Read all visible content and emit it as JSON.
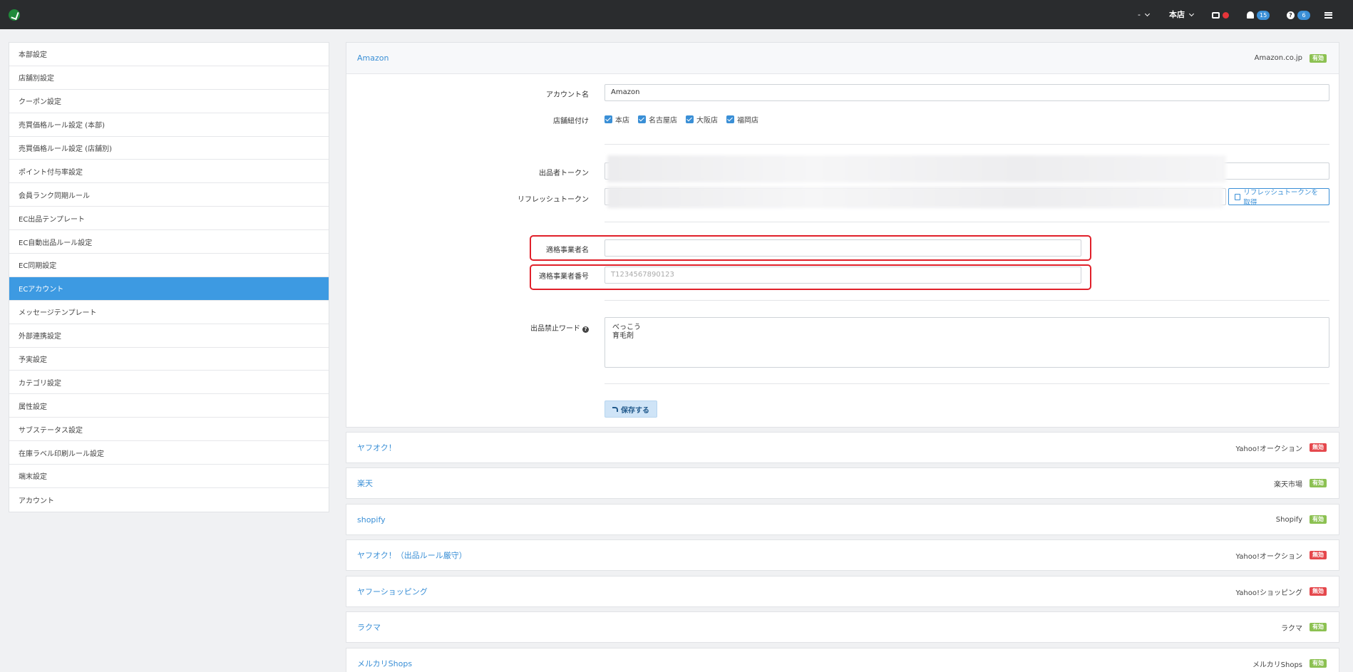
{
  "topbar": {
    "account_label": "-",
    "store_label": "本店",
    "notifications_count": "15",
    "help_count": "6"
  },
  "sidebar": {
    "items": [
      {
        "label": "本部設定"
      },
      {
        "label": "店舗別設定"
      },
      {
        "label": "クーポン設定"
      },
      {
        "label": "売買価格ルール設定 (本部)"
      },
      {
        "label": "売買価格ルール設定 (店舗別)"
      },
      {
        "label": "ポイント付与率設定"
      },
      {
        "label": "会員ランク同期ルール"
      },
      {
        "label": "EC出品テンプレート"
      },
      {
        "label": "EC自動出品ルール設定"
      },
      {
        "label": "EC同期設定"
      },
      {
        "label": "ECアカウント"
      },
      {
        "label": "メッセージテンプレート"
      },
      {
        "label": "外部連携設定"
      },
      {
        "label": "予実設定"
      },
      {
        "label": "カテゴリ設定"
      },
      {
        "label": "属性設定"
      },
      {
        "label": "サブステータス設定"
      },
      {
        "label": "在庫ラベル印刷ルール設定"
      },
      {
        "label": "端末設定"
      },
      {
        "label": "アカウント"
      }
    ],
    "active_index": 10
  },
  "amazon": {
    "title": "Amazon",
    "store": "Amazon.co.jp",
    "status": "有効",
    "account_name_label": "アカウント名",
    "account_name_value": "Amazon",
    "store_link_label": "店舗紐付け",
    "stores": [
      "本店",
      "名古屋店",
      "大阪店",
      "福岡店"
    ],
    "seller_token_label": "出品者トークン",
    "refresh_token_label": "リフレッシュトークン",
    "refresh_button": "リフレッシュトークンを取得",
    "qualified_name_label": "適格事業者名",
    "qualified_name_value": "",
    "qualified_number_label": "適格事業者番号",
    "qualified_number_placeholder": "T1234567890123",
    "banned_words_label": "出品禁止ワード",
    "banned_words_value": "べっこう\n育毛剤",
    "save_button": "保存する"
  },
  "accounts": [
    {
      "title": "ヤフオク！",
      "store": "Yahoo!オークション",
      "status": "無効",
      "active": false
    },
    {
      "title": "楽天",
      "store": "楽天市場",
      "status": "有効",
      "active": true
    },
    {
      "title": "shopify",
      "store": "Shopify",
      "status": "有効",
      "active": true
    },
    {
      "title": "ヤフオク！（出品ルール厳守）",
      "store": "Yahoo!オークション",
      "status": "無効",
      "active": false
    },
    {
      "title": "ヤフーショッピング",
      "store": "Yahoo!ショッピング",
      "status": "無効",
      "active": false
    },
    {
      "title": "ラクマ",
      "store": "ラクマ",
      "status": "有効",
      "active": true
    },
    {
      "title": "メルカリShops",
      "store": "メルカリShops",
      "status": "有効",
      "active": true
    }
  ]
}
